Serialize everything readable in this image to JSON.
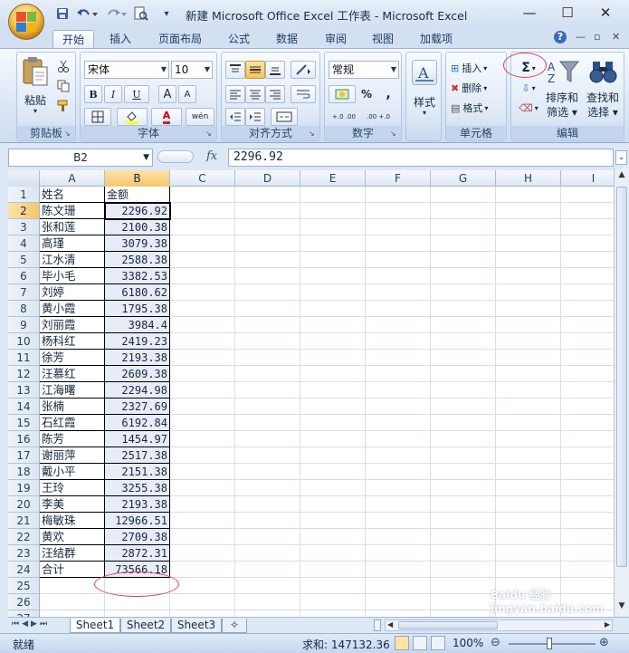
{
  "window": {
    "title": "新建 Microsoft Office Excel 工作表 - Microsoft Excel",
    "minimize_glyph": "—",
    "maximize_glyph": "☐",
    "close_glyph": "✕"
  },
  "tabs": [
    {
      "label": "开始",
      "active": true
    },
    {
      "label": "插入"
    },
    {
      "label": "页面布局"
    },
    {
      "label": "公式"
    },
    {
      "label": "数据"
    },
    {
      "label": "审阅"
    },
    {
      "label": "视图"
    },
    {
      "label": "加载项"
    }
  ],
  "ribbon": {
    "clipboard": {
      "label": "剪贴板",
      "paste": "粘贴"
    },
    "font": {
      "label": "字体",
      "font_name": "宋体",
      "font_size": "10",
      "bold": "B",
      "italic": "I",
      "underline": "U",
      "grow": "A",
      "shrink": "A",
      "font_color_glyph": "A",
      "phonetic": "wén"
    },
    "alignment": {
      "label": "对齐方式"
    },
    "number": {
      "label": "数字",
      "format": "常规",
      "percent": "%",
      "comma": ",",
      "inc_decimal": "+.0 .00",
      "dec_decimal": ".00 +.0"
    },
    "styles": {
      "label": "样式"
    },
    "cells": {
      "label": "单元格",
      "insert": "插入",
      "delete": "删除",
      "format": "格式"
    },
    "editing": {
      "label": "编辑",
      "sum_glyph": "Σ",
      "sort_filter": "排序和 筛选",
      "find_select": "查找和 选择",
      "sort_line1": "排序和",
      "sort_line2": "筛选",
      "find_line1": "查找和",
      "find_line2": "选择"
    }
  },
  "formula_bar": {
    "name_box": "B2",
    "fx": "fx",
    "value": "2296.92"
  },
  "columns": [
    "A",
    "B",
    "C",
    "D",
    "E",
    "F",
    "G",
    "H",
    "I"
  ],
  "rows": [
    {
      "n": "1",
      "a": "姓名",
      "b": "金额"
    },
    {
      "n": "2",
      "a": "陈文珊",
      "b": "2296.92"
    },
    {
      "n": "3",
      "a": "张和莲",
      "b": "2100.38"
    },
    {
      "n": "4",
      "a": "高瑾",
      "b": "3079.38"
    },
    {
      "n": "5",
      "a": "江水清",
      "b": "2588.38"
    },
    {
      "n": "6",
      "a": "毕小毛",
      "b": "3382.53"
    },
    {
      "n": "7",
      "a": "刘婷",
      "b": "6180.62"
    },
    {
      "n": "8",
      "a": "黄小霞",
      "b": "1795.38"
    },
    {
      "n": "9",
      "a": "刘丽霞",
      "b": "3984.4"
    },
    {
      "n": "10",
      "a": "杨科红",
      "b": "2419.23"
    },
    {
      "n": "11",
      "a": "徐芳",
      "b": "2193.38"
    },
    {
      "n": "12",
      "a": "汪慕红",
      "b": "2609.38"
    },
    {
      "n": "13",
      "a": "江海曙",
      "b": "2294.98"
    },
    {
      "n": "14",
      "a": "张楠",
      "b": "2327.69"
    },
    {
      "n": "15",
      "a": "石红霞",
      "b": "6192.84"
    },
    {
      "n": "16",
      "a": "陈芳",
      "b": "1454.97"
    },
    {
      "n": "17",
      "a": "谢丽萍",
      "b": "2517.38"
    },
    {
      "n": "18",
      "a": "戴小平",
      "b": "2151.38"
    },
    {
      "n": "19",
      "a": "王玲",
      "b": "3255.38"
    },
    {
      "n": "20",
      "a": "李美",
      "b": "2193.38"
    },
    {
      "n": "21",
      "a": "梅敏珠",
      "b": "12966.51"
    },
    {
      "n": "22",
      "a": "黄欢",
      "b": "2709.38"
    },
    {
      "n": "23",
      "a": "汪结群",
      "b": "2872.31"
    },
    {
      "n": "24",
      "a": "合计",
      "b": "73566.18"
    },
    {
      "n": "25",
      "a": "",
      "b": ""
    },
    {
      "n": "26",
      "a": "",
      "b": ""
    },
    {
      "n": "27",
      "a": "",
      "b": ""
    }
  ],
  "sheets": [
    "Sheet1",
    "Sheet2",
    "Sheet3"
  ],
  "status": {
    "ready": "就绪",
    "sum": "求和: 147132.36",
    "zoom": "100%"
  },
  "watermark": "Baidu 经验 jingyan.baidu.com",
  "colors": {
    "accent_red": "#e0444a",
    "selected_header": "#f6c66a",
    "ribbon_blue": "#dbe7f5"
  }
}
